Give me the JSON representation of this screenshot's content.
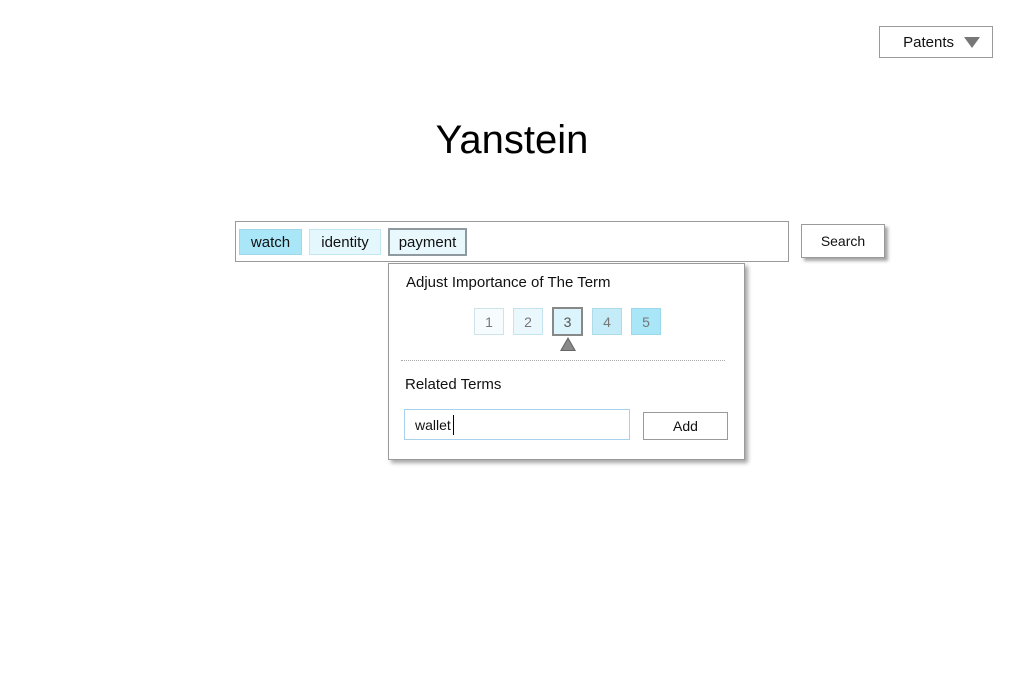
{
  "dropdown": {
    "selected": "Patents",
    "icon": "triangle-down-icon"
  },
  "title": "Yanstein",
  "search": {
    "chips": [
      {
        "label": "watch"
      },
      {
        "label": "identity"
      },
      {
        "label": "payment",
        "selected": true
      }
    ],
    "button_label": "Search"
  },
  "popover": {
    "heading": "Adjust Importance of The Term",
    "scale": [
      "1",
      "2",
      "3",
      "4",
      "5"
    ],
    "selected_value": 3,
    "related_heading": "Related Terms",
    "input_value": "wallet",
    "add_label": "Add"
  },
  "colors": {
    "chip_active": "#a8e6f8",
    "chip_light": "#e4f7fd",
    "border": "#9a9a9a"
  }
}
